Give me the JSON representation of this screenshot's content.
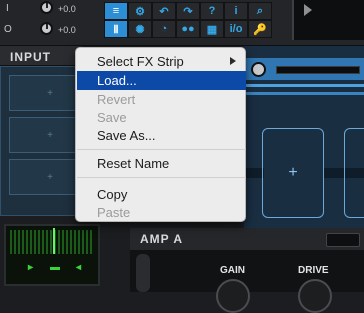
{
  "topbar": {
    "gain_rows": [
      {
        "label": "I",
        "value": "+0.0"
      },
      {
        "label": "O",
        "value": "+0.0"
      }
    ],
    "toolbar_icons": [
      "list-icon",
      "gear-icon",
      "undo-icon",
      "redo-icon",
      "help-icon",
      "info-icon",
      "search-icon",
      "bars-icon",
      "tuner-icon",
      "metronome-icon",
      "record-icon",
      "grid-icon",
      "io-icon",
      "key-icon"
    ],
    "toolbar_glyphs": [
      "≡",
      "⚙",
      "↶",
      "↷",
      "?",
      "i",
      "⌕",
      "Ⅱ",
      "✺",
      "◔",
      "●●",
      "▦",
      "i/o",
      "🔑"
    ]
  },
  "input_panel": {
    "title": "INPUT",
    "slot_plus": "+"
  },
  "fx_chain": {
    "slot_plus": "+"
  },
  "amp_panel": {
    "title": "AMP A",
    "knobs": [
      {
        "label": "GAIN"
      },
      {
        "label": "DRIVE"
      }
    ]
  },
  "context_menu": {
    "items": [
      {
        "label": "Select FX Strip",
        "state": "enabled",
        "submenu": true
      },
      {
        "label": "Load...",
        "state": "highlighted"
      },
      {
        "label": "Revert",
        "state": "disabled"
      },
      {
        "label": "Save",
        "state": "disabled"
      },
      {
        "label": "Save As...",
        "state": "enabled"
      },
      {
        "label": "Reset Name",
        "state": "enabled"
      },
      {
        "label": "Copy",
        "state": "enabled"
      },
      {
        "label": "Paste",
        "state": "disabled"
      }
    ]
  },
  "colors": {
    "menu_highlight": "#0d49a6",
    "accent_blue": "#2c8fd6",
    "meter_green": "#39d439"
  }
}
